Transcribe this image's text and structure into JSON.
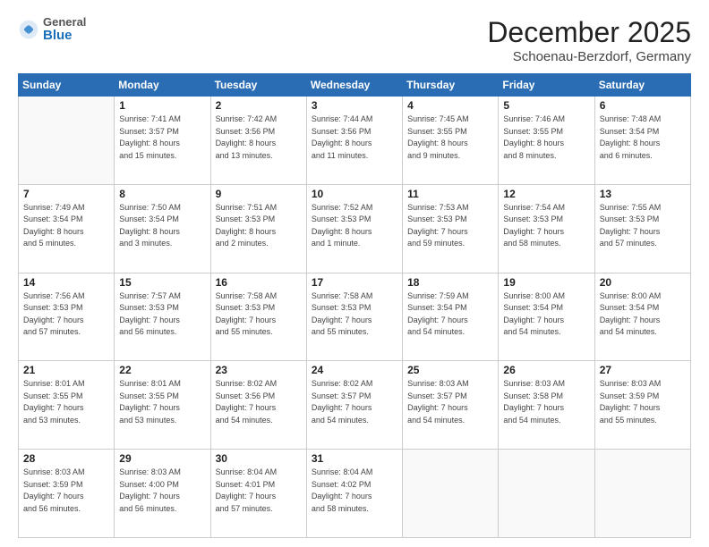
{
  "header": {
    "logo_general": "General",
    "logo_blue": "Blue",
    "title_month": "December 2025",
    "title_location": "Schoenau-Berzdorf, Germany"
  },
  "weekdays": [
    "Sunday",
    "Monday",
    "Tuesday",
    "Wednesday",
    "Thursday",
    "Friday",
    "Saturday"
  ],
  "weeks": [
    [
      {
        "day": "",
        "info": ""
      },
      {
        "day": "1",
        "info": "Sunrise: 7:41 AM\nSunset: 3:57 PM\nDaylight: 8 hours\nand 15 minutes."
      },
      {
        "day": "2",
        "info": "Sunrise: 7:42 AM\nSunset: 3:56 PM\nDaylight: 8 hours\nand 13 minutes."
      },
      {
        "day": "3",
        "info": "Sunrise: 7:44 AM\nSunset: 3:56 PM\nDaylight: 8 hours\nand 11 minutes."
      },
      {
        "day": "4",
        "info": "Sunrise: 7:45 AM\nSunset: 3:55 PM\nDaylight: 8 hours\nand 9 minutes."
      },
      {
        "day": "5",
        "info": "Sunrise: 7:46 AM\nSunset: 3:55 PM\nDaylight: 8 hours\nand 8 minutes."
      },
      {
        "day": "6",
        "info": "Sunrise: 7:48 AM\nSunset: 3:54 PM\nDaylight: 8 hours\nand 6 minutes."
      }
    ],
    [
      {
        "day": "7",
        "info": "Sunrise: 7:49 AM\nSunset: 3:54 PM\nDaylight: 8 hours\nand 5 minutes."
      },
      {
        "day": "8",
        "info": "Sunrise: 7:50 AM\nSunset: 3:54 PM\nDaylight: 8 hours\nand 3 minutes."
      },
      {
        "day": "9",
        "info": "Sunrise: 7:51 AM\nSunset: 3:53 PM\nDaylight: 8 hours\nand 2 minutes."
      },
      {
        "day": "10",
        "info": "Sunrise: 7:52 AM\nSunset: 3:53 PM\nDaylight: 8 hours\nand 1 minute."
      },
      {
        "day": "11",
        "info": "Sunrise: 7:53 AM\nSunset: 3:53 PM\nDaylight: 7 hours\nand 59 minutes."
      },
      {
        "day": "12",
        "info": "Sunrise: 7:54 AM\nSunset: 3:53 PM\nDaylight: 7 hours\nand 58 minutes."
      },
      {
        "day": "13",
        "info": "Sunrise: 7:55 AM\nSunset: 3:53 PM\nDaylight: 7 hours\nand 57 minutes."
      }
    ],
    [
      {
        "day": "14",
        "info": "Sunrise: 7:56 AM\nSunset: 3:53 PM\nDaylight: 7 hours\nand 57 minutes."
      },
      {
        "day": "15",
        "info": "Sunrise: 7:57 AM\nSunset: 3:53 PM\nDaylight: 7 hours\nand 56 minutes."
      },
      {
        "day": "16",
        "info": "Sunrise: 7:58 AM\nSunset: 3:53 PM\nDaylight: 7 hours\nand 55 minutes."
      },
      {
        "day": "17",
        "info": "Sunrise: 7:58 AM\nSunset: 3:53 PM\nDaylight: 7 hours\nand 55 minutes."
      },
      {
        "day": "18",
        "info": "Sunrise: 7:59 AM\nSunset: 3:54 PM\nDaylight: 7 hours\nand 54 minutes."
      },
      {
        "day": "19",
        "info": "Sunrise: 8:00 AM\nSunset: 3:54 PM\nDaylight: 7 hours\nand 54 minutes."
      },
      {
        "day": "20",
        "info": "Sunrise: 8:00 AM\nSunset: 3:54 PM\nDaylight: 7 hours\nand 54 minutes."
      }
    ],
    [
      {
        "day": "21",
        "info": "Sunrise: 8:01 AM\nSunset: 3:55 PM\nDaylight: 7 hours\nand 53 minutes."
      },
      {
        "day": "22",
        "info": "Sunrise: 8:01 AM\nSunset: 3:55 PM\nDaylight: 7 hours\nand 53 minutes."
      },
      {
        "day": "23",
        "info": "Sunrise: 8:02 AM\nSunset: 3:56 PM\nDaylight: 7 hours\nand 54 minutes."
      },
      {
        "day": "24",
        "info": "Sunrise: 8:02 AM\nSunset: 3:57 PM\nDaylight: 7 hours\nand 54 minutes."
      },
      {
        "day": "25",
        "info": "Sunrise: 8:03 AM\nSunset: 3:57 PM\nDaylight: 7 hours\nand 54 minutes."
      },
      {
        "day": "26",
        "info": "Sunrise: 8:03 AM\nSunset: 3:58 PM\nDaylight: 7 hours\nand 54 minutes."
      },
      {
        "day": "27",
        "info": "Sunrise: 8:03 AM\nSunset: 3:59 PM\nDaylight: 7 hours\nand 55 minutes."
      }
    ],
    [
      {
        "day": "28",
        "info": "Sunrise: 8:03 AM\nSunset: 3:59 PM\nDaylight: 7 hours\nand 56 minutes."
      },
      {
        "day": "29",
        "info": "Sunrise: 8:03 AM\nSunset: 4:00 PM\nDaylight: 7 hours\nand 56 minutes."
      },
      {
        "day": "30",
        "info": "Sunrise: 8:04 AM\nSunset: 4:01 PM\nDaylight: 7 hours\nand 57 minutes."
      },
      {
        "day": "31",
        "info": "Sunrise: 8:04 AM\nSunset: 4:02 PM\nDaylight: 7 hours\nand 58 minutes."
      },
      {
        "day": "",
        "info": ""
      },
      {
        "day": "",
        "info": ""
      },
      {
        "day": "",
        "info": ""
      }
    ]
  ]
}
